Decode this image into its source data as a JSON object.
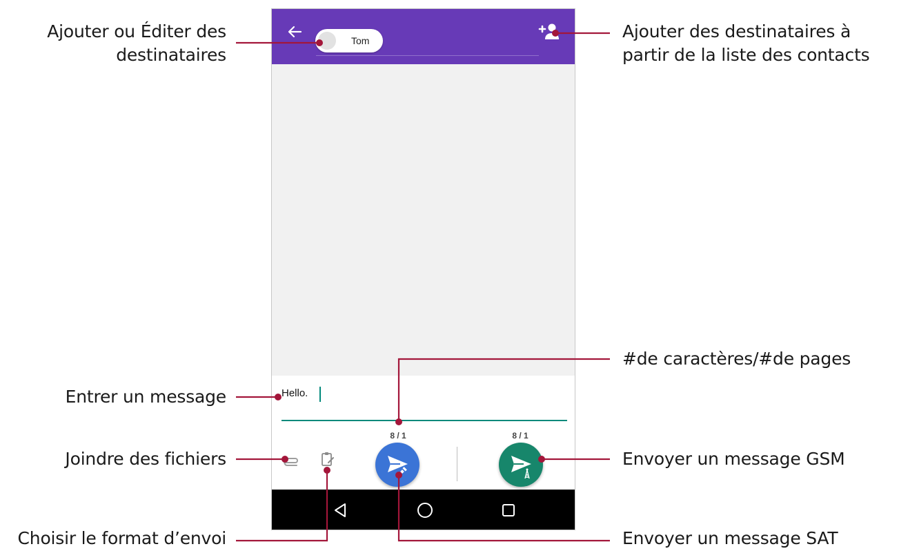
{
  "app": {
    "recipient_chip": {
      "name": "Tom"
    },
    "composer": {
      "message_value": "Hello.",
      "sat_counter": "8 / 1",
      "gsm_counter": "8 / 1"
    },
    "icons": {
      "back": "arrow-back-icon",
      "add_recipient": "person-add-icon",
      "attach": "paperclip-icon",
      "format": "clipboard-edit-icon",
      "send_sat": "send-satellite-icon",
      "send_gsm": "send-antenna-icon",
      "nav_back": "triangle-back-icon",
      "nav_home": "circle-home-icon",
      "nav_recent": "square-recent-icon"
    },
    "colors": {
      "appbar": "#673ab7",
      "accent": "#00897b",
      "sat_button": "#3b74d6",
      "gsm_button": "#17866b",
      "callout_line": "#a3163a"
    }
  },
  "callouts": {
    "edit_recipients": {
      "line1": "Ajouter ou Éditer des",
      "line2": "destinataires"
    },
    "add_from_contacts": {
      "line1": "Ajouter des destinataires à",
      "line2": "partir de la liste des contacts"
    },
    "enter_message": "Entrer un message",
    "char_page_count": "#de caractères/#de pages",
    "attach_files": "Joindre des fichiers",
    "send_gsm": "Envoyer un message GSM",
    "send_format": "Choisir le format d’envoi",
    "send_sat": "Envoyer un message SAT"
  }
}
